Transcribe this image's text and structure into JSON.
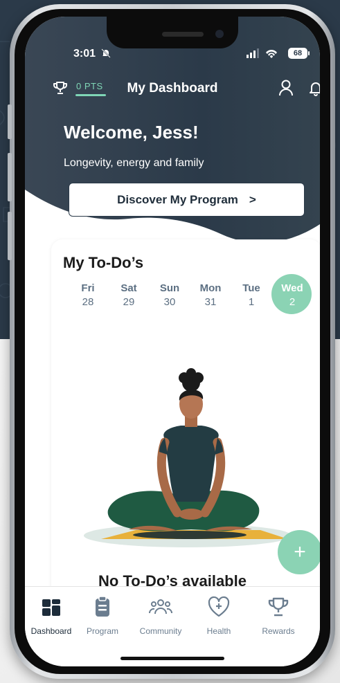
{
  "status_bar": {
    "time": "3:01",
    "battery": "68"
  },
  "header": {
    "points": "0 PTS",
    "title": "My Dashboard"
  },
  "hero": {
    "welcome": "Welcome, Jess!",
    "subtitle": "Longevity, energy and family",
    "cta_label": "Discover My Program",
    "cta_chevron": ">"
  },
  "todos": {
    "title": "My To-Do’s",
    "days": [
      {
        "name": "Fri",
        "date": "28"
      },
      {
        "name": "Sat",
        "date": "29"
      },
      {
        "name": "Sun",
        "date": "30"
      },
      {
        "name": "Mon",
        "date": "31"
      },
      {
        "name": "Tue",
        "date": "1"
      },
      {
        "name": "Wed",
        "date": "2",
        "selected": true
      }
    ],
    "empty_message": "No To-Do’s available",
    "add_label": "+"
  },
  "tabs": [
    {
      "label": "Dashboard",
      "icon": "dashboard-icon",
      "active": true
    },
    {
      "label": "Program",
      "icon": "clipboard-icon"
    },
    {
      "label": "Community",
      "icon": "community-icon"
    },
    {
      "label": "Health",
      "icon": "heart-plus-icon"
    },
    {
      "label": "Rewards",
      "icon": "trophy-icon"
    }
  ],
  "colors": {
    "header_bg": "#2b3a49",
    "accent": "#8bd3b4",
    "points": "#7fd6b6"
  }
}
